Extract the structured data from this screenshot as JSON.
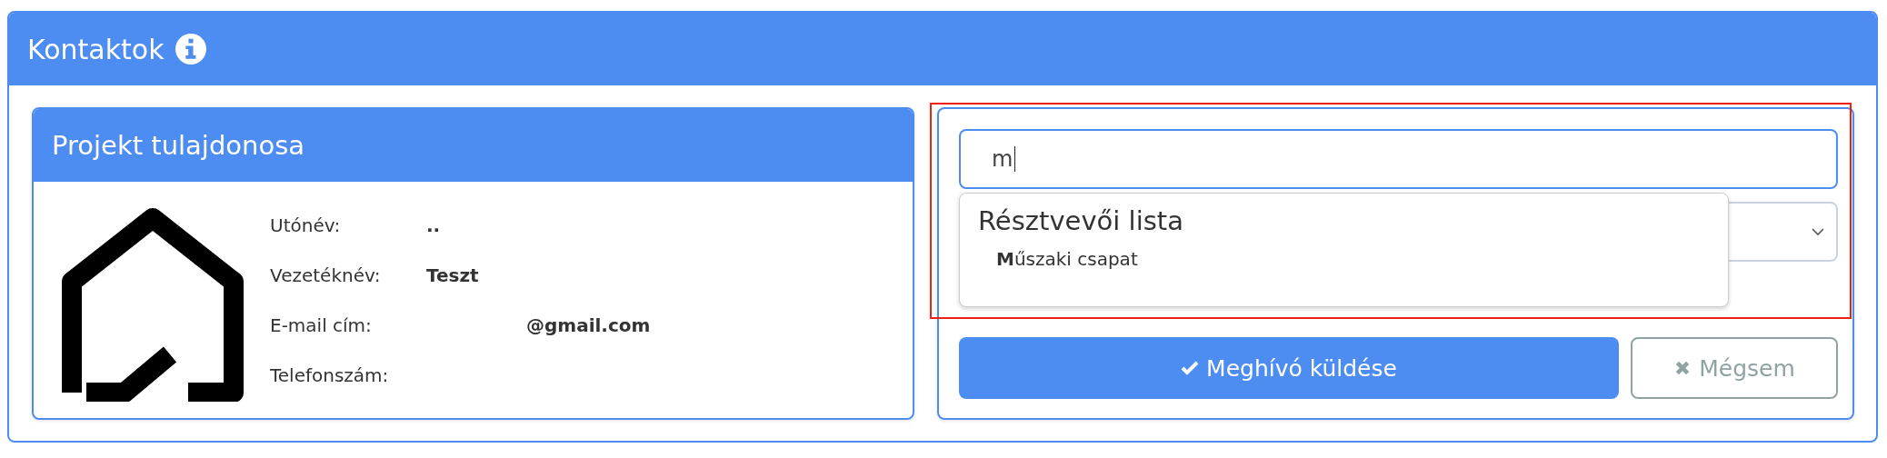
{
  "panel": {
    "title": "Kontaktok"
  },
  "owner_card": {
    "title": "Projekt tulajdonosa",
    "fields": [
      {
        "label": "Utónév:",
        "value": ".."
      },
      {
        "label": "Vezetéknév:",
        "value": "Teszt"
      },
      {
        "label": "E-mail cím:",
        "value": "@gmail.com"
      },
      {
        "label": "Telefonszám:"
      }
    ]
  },
  "invite_form": {
    "search": {
      "value": "m"
    },
    "dropdown": {
      "heading": "Résztvevői lista",
      "options": [
        "**M**űszaki csapat"
      ]
    },
    "buttons": [
      {
        "kind": "primary",
        "label": "Meghívó küldése"
      },
      {
        "kind": "secondary",
        "label": "Mégsem"
      }
    ]
  }
}
